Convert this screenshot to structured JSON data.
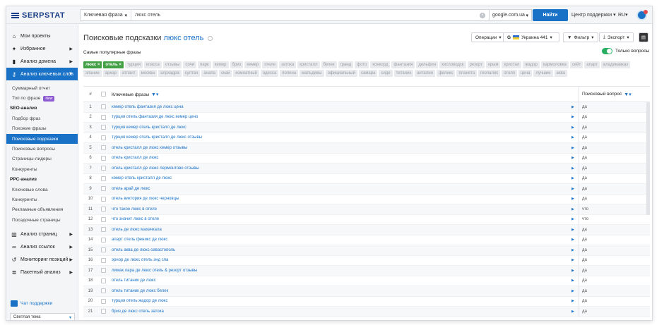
{
  "header": {
    "logo_text": "SERPSTAT",
    "search_type": "Ключевая фраза",
    "search_value": "люкс отель",
    "database": "google.com.ua",
    "find_label": "Найти",
    "support_label": "Центр поддержки",
    "lang": "RU"
  },
  "sidebar": {
    "top_items": [
      {
        "label": "Мои проекты",
        "icon": "home-icon"
      },
      {
        "label": "Избранное",
        "icon": "pin-icon"
      },
      {
        "label": "Анализ домена",
        "icon": "bars-icon"
      },
      {
        "label": "Анализ ключевых слов",
        "icon": "key-icon"
      }
    ],
    "keyword_sub": [
      "Суммарный отчет",
      "Топ по фразе"
    ],
    "new_badge": "New",
    "seo_head": "SEO-анализ",
    "seo_items": [
      "Подбор фраз",
      "Похожие фразы",
      "Поисковые подсказки",
      "Поисковые вопросы",
      "Страницы-лидеры",
      "Конкуренты"
    ],
    "ppc_head": "PPC-анализ",
    "ppc_items": [
      "Ключевые слова",
      "Конкуренты",
      "Рекламные объявления",
      "Посадочные страницы"
    ],
    "bottom_items": [
      {
        "label": "Анализ страниц",
        "icon": "chart-icon"
      },
      {
        "label": "Анализ ссылок",
        "icon": "link-icon"
      },
      {
        "label": "Мониторинг позиций",
        "icon": "history-icon"
      },
      {
        "label": "Пакетный анализ",
        "icon": "stack-icon"
      }
    ],
    "chat_label": "Чат поддержки",
    "theme_label": "Светлая тема"
  },
  "main": {
    "title_prefix": "Поисковые подсказки",
    "title_keyword": "люкс отель",
    "operations_label": "Операции",
    "region_label": "Украина 441",
    "filter_label": "Фильтр",
    "export_label": "Экспорт",
    "popular_title": "Самые популярные фразы",
    "only_questions_label": "Только вопросы",
    "active_tags": [
      "люкс ×",
      "отель ×"
    ],
    "tags": [
      "турция",
      "класса",
      "отзывы",
      "сочи",
      "парк",
      "кемер",
      "бриз",
      "кемер",
      "отеле",
      "затока",
      "кристалл",
      "белек",
      "гранд",
      "фото",
      "конкорд",
      "фантазия",
      "дельфин",
      "кисловодск",
      "резорт",
      "крым",
      "кристал",
      "жадор",
      "кармоловка",
      "сейт",
      "апарт",
      "владикавказ",
      "элание",
      "аркор",
      "атлант",
      "москва",
      "алрхадра",
      "султан",
      "анапа",
      "скай",
      "комнатный",
      "одесса",
      "полена",
      "мальдивы",
      "официальный",
      "самара",
      "сиде",
      "титаник",
      "анталия",
      "феликс",
      "планета",
      "геопалис",
      "отеля",
      "цена",
      "лучшие",
      "аква"
    ],
    "columns": {
      "num": "#",
      "keyword": "Ключевые фразы",
      "question": "Поисковый вопрос"
    },
    "rows": [
      {
        "n": "1",
        "kw": "кемер отель фантазия де люкс цена",
        "q": "да"
      },
      {
        "n": "2",
        "kw": "турция отель фантазия де люкс кемер цено",
        "q": "да"
      },
      {
        "n": "3",
        "kw": "турция кемер отель кристалл де люкс",
        "q": "да"
      },
      {
        "n": "4",
        "kw": "турция кемер отель кристалл де люкс отзывы",
        "q": "да"
      },
      {
        "n": "5",
        "kw": "отель кристалл де люкс кемер отзывы",
        "q": "да"
      },
      {
        "n": "6",
        "kw": "отель кристалл де люкс",
        "q": "да"
      },
      {
        "n": "7",
        "kw": "отель кристалл де люкс лермонтово отзывы",
        "q": "да"
      },
      {
        "n": "8",
        "kw": "кемер отель кристалл де люкс",
        "q": "да"
      },
      {
        "n": "9",
        "kw": "отель арай де люкс",
        "q": "да"
      },
      {
        "n": "10",
        "kw": "отель виктория де люкс черновцы",
        "q": "да"
      },
      {
        "n": "11",
        "kw": "что такое люкс в отеле",
        "q": "что"
      },
      {
        "n": "12",
        "kw": "что значит люкс в отеле",
        "q": "что"
      },
      {
        "n": "13",
        "kw": "отель де люкс махачкала",
        "q": "да"
      },
      {
        "n": "14",
        "kw": "апарт отель феникс де люкс",
        "q": "да"
      },
      {
        "n": "15",
        "kw": "отель аква де люкс севастополь",
        "q": "да"
      },
      {
        "n": "16",
        "kw": "эрнор де люкс отель энд спа",
        "q": "да"
      },
      {
        "n": "17",
        "kw": "лимак лара де люкс отель & резорт отзывы",
        "q": "да"
      },
      {
        "n": "18",
        "kw": "отель титаник де люкс",
        "q": "да"
      },
      {
        "n": "19",
        "kw": "отель титаник де люкс белек",
        "q": "да"
      },
      {
        "n": "20",
        "kw": "турция отель жадор де люкс",
        "q": "да"
      },
      {
        "n": "21",
        "kw": "бриз де люкс отель затока",
        "q": "да"
      }
    ]
  }
}
